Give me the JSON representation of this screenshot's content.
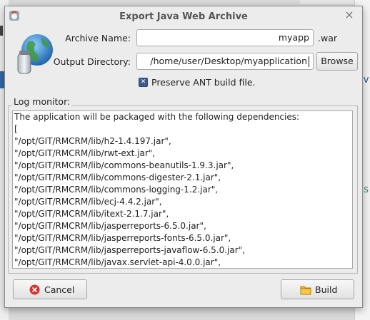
{
  "dialog": {
    "title": "Export Java Web Archive",
    "close_glyph": "×",
    "app_icon": "java-duke-icon"
  },
  "form": {
    "archive_name_label": "Archive Name:",
    "archive_name_value": "myapp",
    "archive_suffix": ".war",
    "output_dir_label": "Output Directory:",
    "output_dir_value": "/home/user/Desktop/myapplication",
    "browse_label": "Browse",
    "preserve_ant_label": "Preserve ANT build file.",
    "preserve_ant_checked": true
  },
  "log_monitor": {
    "label": "Log monitor:",
    "lines": [
      "The application will be packaged with the following dependencies:",
      "[",
      " \"/opt/GIT/RMCRM/lib/h2-1.4.197.jar\",",
      " \"/opt/GIT/RMCRM/lib/rwt-ext.jar\",",
      " \"/opt/GIT/RMCRM/lib/commons-beanutils-1.9.3.jar\",",
      " \"/opt/GIT/RMCRM/lib/commons-digester-2.1.jar\",",
      " \"/opt/GIT/RMCRM/lib/commons-logging-1.2.jar\",",
      " \"/opt/GIT/RMCRM/lib/ecj-4.4.2.jar\",",
      " \"/opt/GIT/RMCRM/lib/itext-2.1.7.jar\",",
      " \"/opt/GIT/RMCRM/lib/jasperreports-6.5.0.jar\",",
      " \"/opt/GIT/RMCRM/lib/jasperreports-fonts-6.5.0.jar\",",
      " \"/opt/GIT/RMCRM/lib/jasperreports-javaflow-6.5.0.jar\",",
      " \"/opt/GIT/RMCRM/lib/javax.servlet-api-4.0.0.jar\","
    ]
  },
  "actions": {
    "cancel_label": "Cancel",
    "build_label": "Build"
  },
  "background": {
    "right_text_1": "iv",
    "right_text_2": "ss"
  },
  "colors": {
    "dialog_bg": "#ececec",
    "checkbox_fill": "#3c5a8c",
    "cancel_icon": "#d9342b",
    "build_icon": "#f0b429"
  }
}
